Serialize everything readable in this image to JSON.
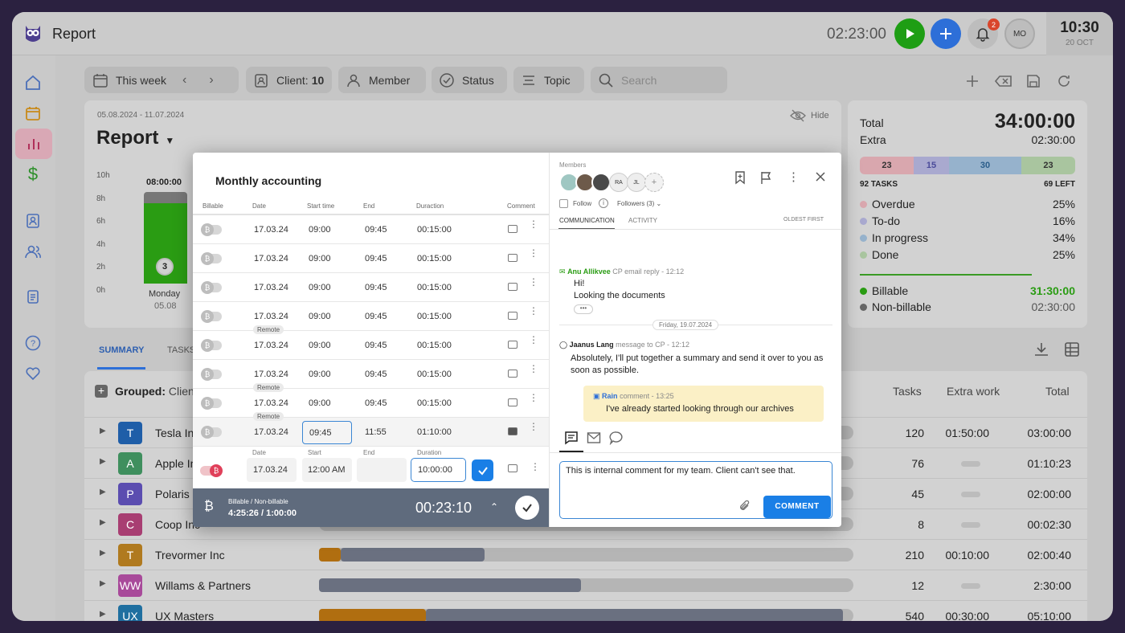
{
  "app": {
    "title": "Report",
    "timer": "02:23:00",
    "notif_count": "2",
    "avatar": "MO",
    "time": "10:30",
    "date": "20 OCT"
  },
  "filters": {
    "period": "This week",
    "client_label": "Client:",
    "client_count": "10",
    "member": "Member",
    "status": "Status",
    "topic": "Topic",
    "search_placeholder": "Search"
  },
  "report": {
    "range": "05.08.2024 - 11.07.2024",
    "title": "Report",
    "hide": "Hide",
    "y_ticks": [
      "10h",
      "8h",
      "6h",
      "4h",
      "2h",
      "0h"
    ],
    "bar_label": "08:00:00",
    "bar_count": "3",
    "day": "Monday",
    "day_date": "05.08"
  },
  "totals": {
    "total_label": "Total",
    "total": "34:00:00",
    "extra_label": "Extra",
    "extra": "02:30:00",
    "segments": [
      "23",
      "15",
      "30",
      "23"
    ],
    "tasks": "92 TASKS",
    "left": "69 LEFT",
    "stats": [
      {
        "label": "Overdue",
        "value": "25%",
        "color": "#d9a7ae"
      },
      {
        "label": "To-do",
        "value": "16%",
        "color": "#a9a9cf"
      },
      {
        "label": "In progress",
        "value": "34%",
        "color": "#96b2cc"
      },
      {
        "label": "Done",
        "value": "25%",
        "color": "#a9c59f"
      }
    ],
    "billable_label": "Billable",
    "billable": "31:30:00",
    "nonbillable_label": "Non-billable",
    "nonbillable": "02:30:00"
  },
  "tabs": {
    "summary": "SUMMARY",
    "tasks": "TASKS"
  },
  "table": {
    "grouped_label": "Grouped:",
    "grouped_value": "Client",
    "headers": {
      "tasks": "Tasks",
      "extra": "Extra work",
      "total": "Total"
    },
    "rows": [
      {
        "initial": "T",
        "name": "Tesla Inc",
        "color": "#1f5ea8",
        "tasks": "120",
        "extra": "01:50:00",
        "total": "03:00:00"
      },
      {
        "initial": "A",
        "name": "Apple Inc",
        "color": "#3f8f5e",
        "tasks": "76",
        "extra": "",
        "total": "01:10:23"
      },
      {
        "initial": "P",
        "name": "Polaris Inc",
        "color": "#5b4db0",
        "tasks": "45",
        "extra": "",
        "total": "02:00:00"
      },
      {
        "initial": "C",
        "name": "Coop Inc",
        "color": "#a83e72",
        "tasks": "8",
        "extra": "",
        "total": "00:02:30"
      },
      {
        "initial": "T",
        "name": "Trevormer Inc",
        "color": "#b07a1f",
        "tasks": "210",
        "extra": "00:10:00",
        "total": "02:00:40"
      },
      {
        "initial": "WW",
        "name": "Willams & Partners",
        "color": "#a84a9a",
        "tasks": "12",
        "extra": "",
        "total": "2:30:00"
      },
      {
        "initial": "UX",
        "name": "UX Masters",
        "color": "#1f6fa0",
        "tasks": "540",
        "extra": "00:30:00",
        "total": "05:10:00"
      }
    ]
  },
  "modal": {
    "title": "Monthly accounting",
    "cols": {
      "billable": "Billable",
      "date": "Date",
      "start": "Start time",
      "end": "End",
      "duration": "Duraction",
      "comment": "Comment"
    },
    "entries": [
      {
        "date": "17.03.24",
        "start": "09:00",
        "end": "09:45",
        "duration": "00:15:00",
        "remote": ""
      },
      {
        "date": "17.03.24",
        "start": "09:00",
        "end": "09:45",
        "duration": "00:15:00",
        "remote": ""
      },
      {
        "date": "17.03.24",
        "start": "09:00",
        "end": "09:45",
        "duration": "00:15:00",
        "remote": ""
      },
      {
        "date": "17.03.24",
        "start": "09:00",
        "end": "09:45",
        "duration": "00:15:00",
        "remote": ""
      },
      {
        "date": "17.03.24",
        "start": "09:00",
        "end": "09:45",
        "duration": "00:15:00",
        "remote": "Remote"
      },
      {
        "date": "17.03.24",
        "start": "09:00",
        "end": "09:45",
        "duration": "00:15:00",
        "remote": ""
      },
      {
        "date": "17.03.24",
        "start": "09:00",
        "end": "09:45",
        "duration": "00:15:00",
        "remote": "Remote"
      },
      {
        "date": "17.03.24",
        "start": "09:45",
        "end": "11:55",
        "duration": "01:10:00",
        "remote": "Remote"
      }
    ],
    "new_entry": {
      "date_label": "Date",
      "start_label": "Start",
      "end_label": "End",
      "duration_label": "Duration",
      "date": "17.03.24",
      "start": "12:00 AM",
      "end": "",
      "duration": "10:00:00"
    },
    "footer": {
      "label": "Billable / Non-billable",
      "values": "4:25:26 / 1:00:00",
      "timer": "00:23:10"
    },
    "members_label": "Members",
    "member_initials": [
      "RA",
      "JL"
    ],
    "follow": "Follow",
    "followers": "Followers (3)",
    "comm_tab": "COMMUNICATION",
    "activity_tab": "ACTIVITY",
    "sort": "OLDEST FIRST",
    "messages": {
      "m1_author": "Anu Allikvee",
      "m1_meta": "CP email reply - 12:12",
      "m1_l1": "Hi!",
      "m1_l2": "Looking the documents",
      "date_sep": "Friday, 19.07.2024",
      "m2_author": "Jaanus Lang",
      "m2_meta": "message to CP - 12:12",
      "m2_text": "Absolutely, I'll put together a summary and send it over to you as soon as possible.",
      "m3_author": "Rain",
      "m3_meta": "comment - 13:25",
      "m3_text": "I've already started looking through our archives"
    },
    "comment_text": "This is internal comment for my team. Client can't see that.",
    "comment_button": "COMMENT"
  },
  "colors": {
    "accent_blue": "#1a7fe6",
    "green": "#3aa51c",
    "brand_purple": "#4d3f8f"
  }
}
